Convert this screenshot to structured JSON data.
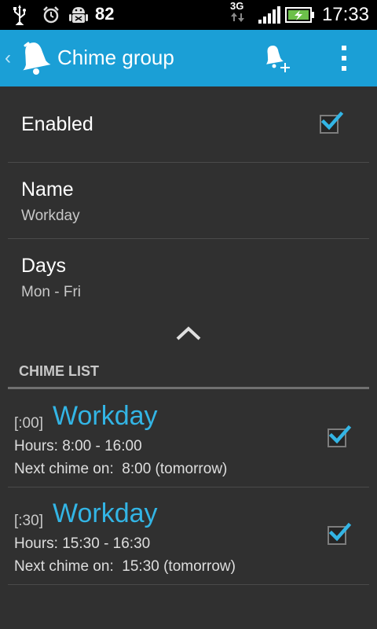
{
  "status_bar": {
    "battery_level": "82",
    "network": "3G",
    "time": "17:33",
    "icons": [
      "usb-icon",
      "alarm-icon",
      "android-debug-icon",
      "signal-icon",
      "battery-charging-icon"
    ]
  },
  "action_bar": {
    "title": "Chime group",
    "back_glyph": "‹",
    "icons": [
      "bell-logo-icon",
      "add-bell-icon",
      "overflow-menu-icon"
    ]
  },
  "prefs": {
    "enabled": {
      "title": "Enabled",
      "checked": true
    },
    "name": {
      "title": "Name",
      "summary": "Workday"
    },
    "days": {
      "title": "Days",
      "summary": "Mon - Fri"
    }
  },
  "chime_list": {
    "header": "CHIME LIST",
    "items": [
      {
        "minute": "[:00]",
        "name": "Workday",
        "hours": "Hours: 8:00 - 16:00",
        "next": "Next chime on:  8:00 (tomorrow)",
        "checked": true
      },
      {
        "minute": "[:30]",
        "name": "Workday",
        "hours": "Hours: 15:30 - 16:30",
        "next": "Next chime on:  15:30 (tomorrow)",
        "checked": true
      }
    ]
  },
  "colors": {
    "accent": "#33b5e5",
    "action_bar": "#1b9fd6",
    "background": "#303030",
    "status_bar": "#000000"
  }
}
